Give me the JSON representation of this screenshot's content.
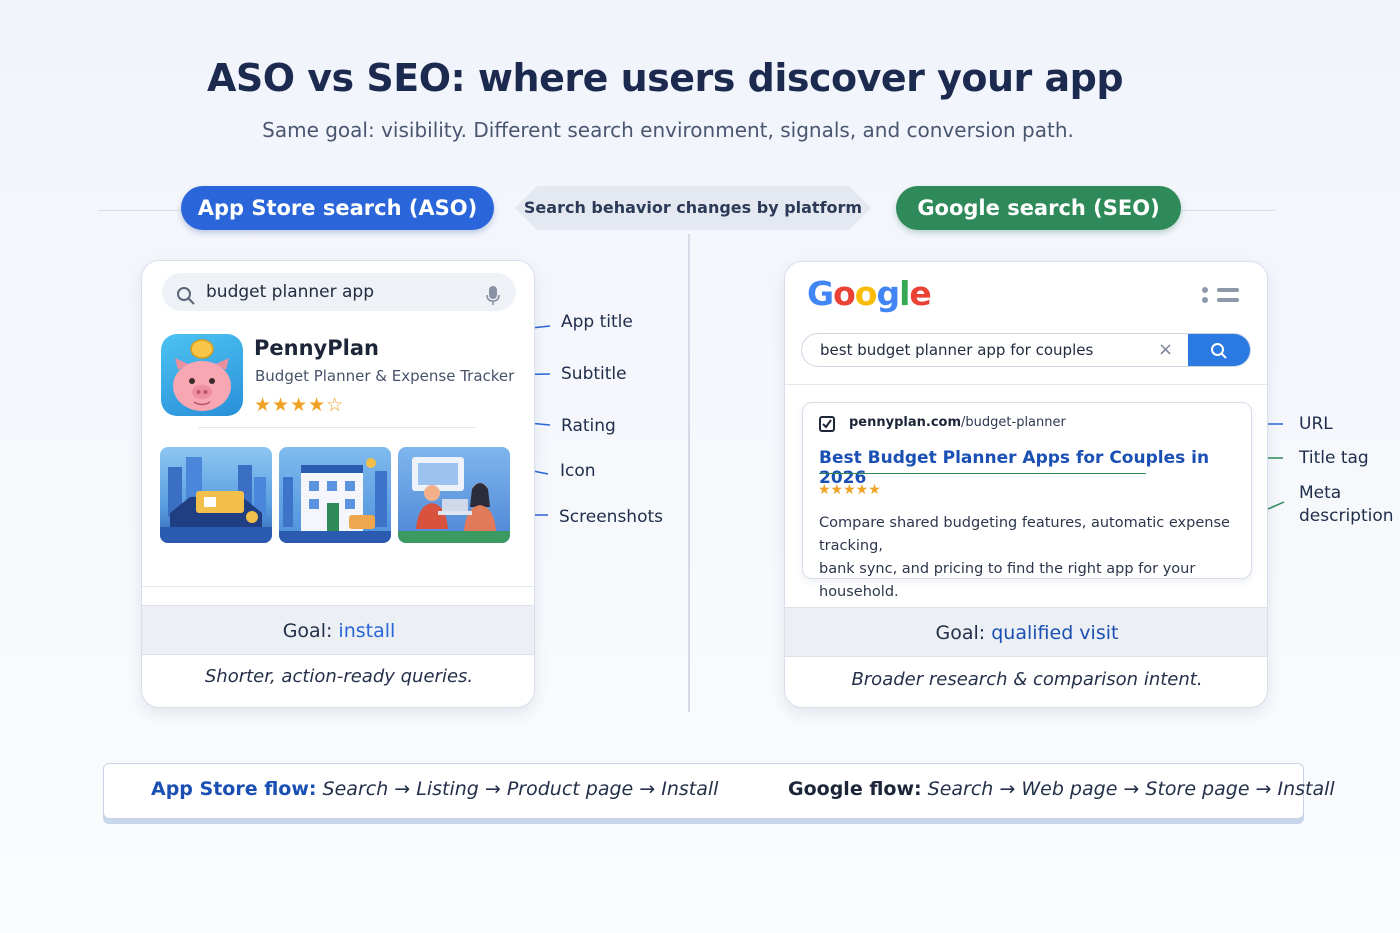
{
  "header": {
    "title": "ASO vs SEO: where users discover your app",
    "subtitle": "Same goal: visibility. Different search environment, signals, and conversion path."
  },
  "pills": {
    "aso": "App Store search (ASO)",
    "center": "Search behavior changes by platform",
    "seo": "Google search (SEO)"
  },
  "aso_card": {
    "search_query": "budget planner app",
    "app_name": "PennyPlan",
    "app_subtitle": "Budget Planner & Expense Tracker",
    "stars": "★★★★☆",
    "goal_label": "Goal:",
    "goal_value": "install",
    "note": "Shorter, action-ready queries."
  },
  "aso_callouts": {
    "app_title": "App title",
    "subtitle": "Subtitle",
    "rating": "Rating",
    "icon": "Icon",
    "screenshots": "Screenshots"
  },
  "seo_card": {
    "logo": [
      "G",
      "o",
      "o",
      "g",
      "l",
      "e"
    ],
    "search_query": "best budget planner app for couples",
    "clear": "×",
    "result": {
      "url_domain": "pennyplan.com",
      "url_path": "/budget-planner",
      "title": "Best Budget Planner Apps for Couples in 2026",
      "stars": "★★★★★",
      "description_line1": "Compare shared budgeting features, automatic expense tracking,",
      "description_line2": "bank sync, and pricing to find the right app for your household."
    },
    "goal_label": "Goal:",
    "goal_value": "qualified visit",
    "note": "Broader research & comparison intent."
  },
  "seo_callouts": {
    "url": "URL",
    "title_tag": "Title tag",
    "meta_line1": "Meta",
    "meta_line2": "description"
  },
  "flow": {
    "aso_label": "App Store flow:",
    "aso_steps": "Search → Listing → Product page → Install",
    "seo_label": "Google flow:",
    "seo_steps": "Search → Web page → Store page → Install"
  },
  "colors": {
    "aso_blue": "#2a66d9",
    "seo_green": "#2f8a5a",
    "star": "#f0a225",
    "link_blue": "#1a4fb3"
  }
}
